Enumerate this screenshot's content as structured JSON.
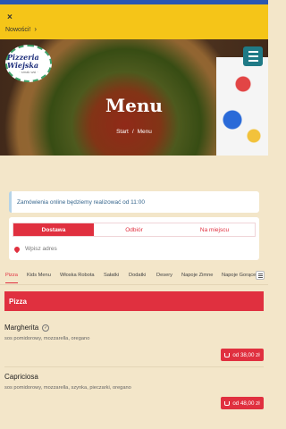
{
  "notice": {
    "close_glyph": "×",
    "news_label": "Nowości!",
    "news_chevron": "›"
  },
  "hero": {
    "logo_line1": "Pizzeria Wiejska",
    "logo_line2": "· smak wsi ·",
    "title": "Menu",
    "breadcrumb": {
      "start": "Start",
      "separator": "/",
      "current": "Menu"
    }
  },
  "info_text": "Zamówienia online będziemy realizować od 11:00",
  "delivery": {
    "tabs": [
      "Dostawa",
      "Odbiór",
      "Na miejscu"
    ],
    "active_tab": "Dostawa",
    "address_placeholder": "Wpisz adres"
  },
  "categories": [
    "Pizza",
    "Kids Menu",
    "Włoska Robota",
    "Sałatki",
    "Dodatki",
    "Desery",
    "Napoje Zimne",
    "Napoje Gorące"
  ],
  "active_category": "Pizza",
  "section_title": "Pizza",
  "products": [
    {
      "name": "Margherita",
      "desc": "sos pomidorowy, mozzarella, oregano",
      "price": "od 38,00 zł",
      "badge": true
    },
    {
      "name": "Capriciosa",
      "desc": "sos pomidorowy, mozzarella, szynka, pieczarki, oregano",
      "price": "od 48,00 zł",
      "badge": false
    }
  ],
  "colors": {
    "accent": "#e0303f",
    "notice_bg": "#f5c518",
    "page_bg": "#f3e6c9",
    "menu_button": "#1f7a86"
  },
  "icons": {
    "close": "close-icon",
    "chevron": "chevron-right-icon",
    "menu": "hamburger-icon",
    "pin": "location-pin-icon",
    "cart": "cart-icon",
    "more": "more-categories-icon"
  }
}
